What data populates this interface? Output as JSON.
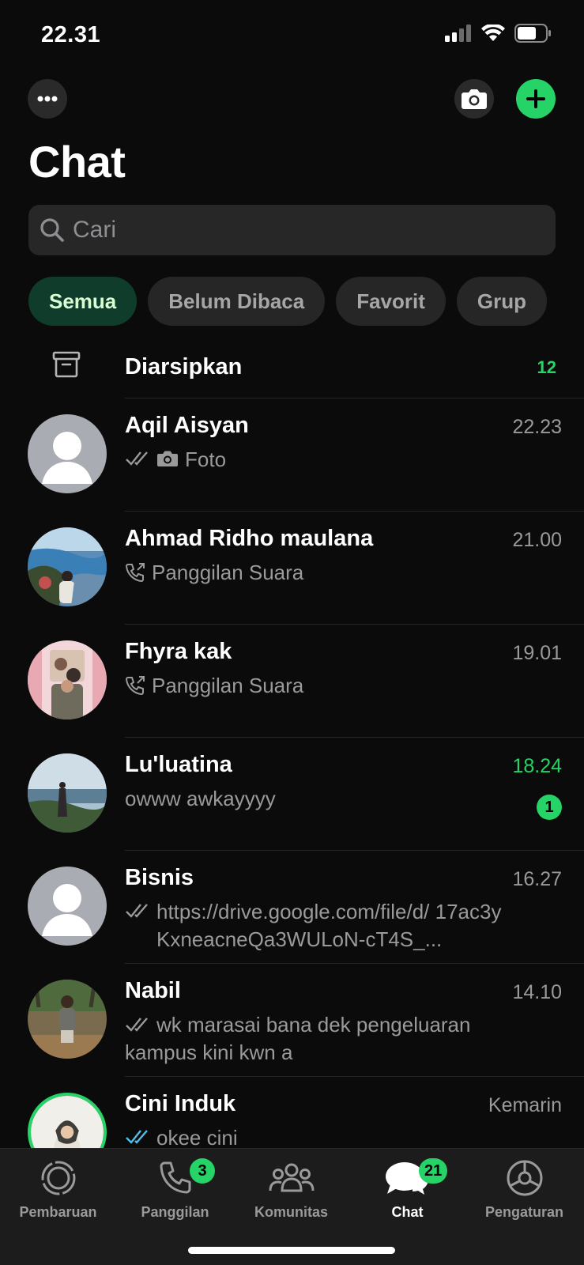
{
  "status_bar": {
    "time": "22.31"
  },
  "header": {
    "title": "Chat"
  },
  "search": {
    "placeholder": "Cari"
  },
  "filters": [
    {
      "label": "Semua",
      "active": true
    },
    {
      "label": "Belum Dibaca",
      "active": false
    },
    {
      "label": "Favorit",
      "active": false
    },
    {
      "label": "Grup",
      "active": false
    }
  ],
  "archived": {
    "label": "Diarsipkan",
    "count": "12"
  },
  "chats": [
    {
      "name": "Aqil Aisyan",
      "time": "22.23",
      "preview": "Foto",
      "preview_icon": "camera-icon",
      "status": "read-grey"
    },
    {
      "name": "Ahmad Ridho maulana",
      "time": "21.00",
      "preview": "Panggilan Suara",
      "preview_icon": "outgoing-call-icon"
    },
    {
      "name": "Fhyra kak",
      "time": "19.01",
      "preview": "Panggilan Suara",
      "preview_icon": "outgoing-call-icon"
    },
    {
      "name": "Lu'luatina",
      "time": "18.24",
      "preview": "owww awkayyyy",
      "unread": "1"
    },
    {
      "name": "Bisnis",
      "time": "16.27",
      "preview": "https://drive.google.com/file/d/ 17ac3yKxneacneQa3WULoN-cT4S_...",
      "status": "read-grey"
    },
    {
      "name": "Nabil",
      "time": "14.10",
      "preview": "wk marasai bana dek pengeluaran kampus kini kwn a",
      "status": "read-grey"
    },
    {
      "name": "Cini Induk",
      "time": "Kemarin",
      "preview": "okee cini",
      "status": "read-blue"
    }
  ],
  "tabs": [
    {
      "label": "Pembaruan",
      "icon": "updates-icon"
    },
    {
      "label": "Panggilan",
      "icon": "phone-icon",
      "badge": "3"
    },
    {
      "label": "Komunitas",
      "icon": "communities-icon"
    },
    {
      "label": "Chat",
      "icon": "chats-icon",
      "badge": "21",
      "active": true
    },
    {
      "label": "Pengaturan",
      "icon": "settings-icon"
    }
  ],
  "colors": {
    "accent": "#25d366",
    "background": "#0b0b0b",
    "read_blue": "#53bdeb"
  }
}
